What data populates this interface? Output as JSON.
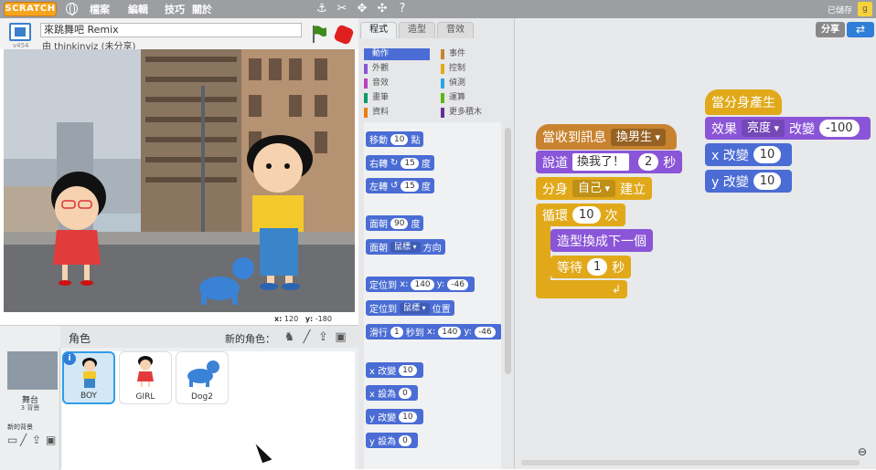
{
  "topbar": {
    "logo": "SCRATCH",
    "menus": [
      "檔案",
      "編輯",
      "技巧",
      "關於"
    ],
    "saved_status": "已儲存",
    "icons": [
      "globe-icon",
      "duplicate-icon",
      "cut-icon",
      "grow-icon",
      "shrink-icon",
      "help-icon"
    ]
  },
  "stage_header": {
    "project_title": "來跳舞吧 Remix",
    "author_line": "由 thinkinviz (未分享)",
    "version": "v454"
  },
  "stage": {
    "mouse_x_label": "x:",
    "mouse_x": "120",
    "mouse_y_label": "y:",
    "mouse_y": "-180"
  },
  "sprites_pane": {
    "title": "角色",
    "new_sprite_label": "新的角色：",
    "stage_name": "舞台",
    "stage_backdrops": "3 背景",
    "new_backdrop_label": "新的背景",
    "sprites": [
      {
        "name": "BOY",
        "selected": true
      },
      {
        "name": "GIRL",
        "selected": false
      },
      {
        "name": "Dog2",
        "selected": false
      }
    ]
  },
  "tabs": [
    "程式",
    "造型",
    "音效"
  ],
  "categories": {
    "left": [
      {
        "label": "動作",
        "color": "#4a6cd4",
        "active": true
      },
      {
        "label": "外觀",
        "color": "#8a55d7"
      },
      {
        "label": "音效",
        "color": "#bb42c3"
      },
      {
        "label": "畫筆",
        "color": "#0e9a6c"
      },
      {
        "label": "資料",
        "color": "#ee7d16"
      }
    ],
    "right": [
      {
        "label": "事件",
        "color": "#c88330"
      },
      {
        "label": "控制",
        "color": "#e1a91a"
      },
      {
        "label": "偵測",
        "color": "#2ca5e2"
      },
      {
        "label": "運算",
        "color": "#5cb712"
      },
      {
        "label": "更多積木",
        "color": "#632d99"
      }
    ]
  },
  "palette": {
    "move": {
      "pre": "移動",
      "val": "10",
      "post": "點"
    },
    "turn_right": {
      "pre": "右轉",
      "val": "15",
      "post": "度"
    },
    "turn_left": {
      "pre": "左轉",
      "val": "15",
      "post": "度"
    },
    "point_dir": {
      "pre": "面朝",
      "val": "90",
      "post": "度"
    },
    "point_towards": {
      "pre": "面朝",
      "val": "鼠標",
      "post": "方向"
    },
    "goto_xy": {
      "pre": "定位到",
      "xl": "x:",
      "x": "140",
      "yl": "y:",
      "y": "-46"
    },
    "goto": {
      "pre": "定位到",
      "val": "鼠標",
      "post": "位置"
    },
    "glide": {
      "pre": "滑行",
      "secs": "1",
      "mid": "秒到",
      "xl": "x:",
      "x": "140",
      "yl": "y:",
      "y": "-46"
    },
    "change_x": {
      "pre": "x 改變",
      "val": "10"
    },
    "set_x": {
      "pre": "x 設為",
      "val": "0"
    },
    "change_y": {
      "pre": "y 改變",
      "val": "10"
    },
    "set_y": {
      "pre": "y 設為",
      "val": "0"
    }
  },
  "script1": {
    "hat_pre": "當收到訊息",
    "hat_msg": "換男生",
    "say_pre": "說道",
    "say_text": "換我了！",
    "say_secs": "2",
    "say_post": "秒",
    "clone_pre": "分身",
    "clone_target": "自己",
    "clone_post": "建立",
    "repeat_pre": "循環",
    "repeat_count": "10",
    "repeat_post": "次",
    "next_costume": "造型換成下一個",
    "wait_pre": "等待",
    "wait_secs": "1",
    "wait_post": "秒"
  },
  "script2": {
    "hat": "當分身產生",
    "effect_pre": "效果",
    "effect_name": "亮度",
    "effect_mid": "改變",
    "effect_val": "-100",
    "change_x_pre": "x 改變",
    "change_x_val": "10",
    "change_y_pre": "y 改變",
    "change_y_val": "10"
  },
  "actions": {
    "share": "分享",
    "remix_icon": "remix-icon"
  }
}
